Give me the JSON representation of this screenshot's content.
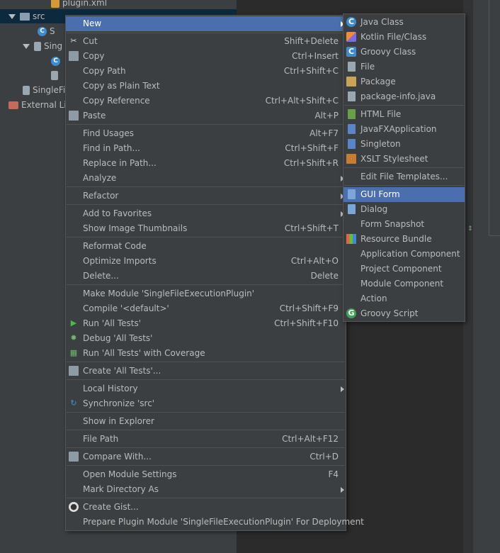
{
  "tree": {
    "plugin_xml": "plugin.xml",
    "src": "src",
    "item_s": "S",
    "sing": "Sing",
    "singlefi": "SingleFi",
    "external_libs": "External Libr"
  },
  "main_menu": {
    "new": "New",
    "cut": "Cut",
    "cut_sc": "Shift+Delete",
    "copy": "Copy",
    "copy_sc": "Ctrl+Insert",
    "copy_path": "Copy Path",
    "copy_path_sc": "Ctrl+Shift+C",
    "copy_plain": "Copy as Plain Text",
    "copy_ref": "Copy Reference",
    "copy_ref_sc": "Ctrl+Alt+Shift+C",
    "paste": "Paste",
    "paste_sc": "Alt+P",
    "find_usages": "Find Usages",
    "find_usages_sc": "Alt+F7",
    "find_path": "Find in Path...",
    "find_path_sc": "Ctrl+Shift+F",
    "replace_path": "Replace in Path...",
    "replace_path_sc": "Ctrl+Shift+R",
    "analyze": "Analyze",
    "refactor": "Refactor",
    "add_fav": "Add to Favorites",
    "show_thumbs": "Show Image Thumbnails",
    "show_thumbs_sc": "Ctrl+Shift+T",
    "reformat": "Reformat Code",
    "optimize": "Optimize Imports",
    "optimize_sc": "Ctrl+Alt+O",
    "delete": "Delete...",
    "delete_sc": "Delete",
    "make_module": "Make Module 'SingleFileExecutionPlugin'",
    "compile": "Compile '<default>'",
    "compile_sc": "Ctrl+Shift+F9",
    "run_tests": "Run 'All Tests'",
    "run_tests_sc": "Ctrl+Shift+F10",
    "debug_tests": "Debug 'All Tests'",
    "run_coverage": "Run 'All Tests' with Coverage",
    "create_tests": "Create 'All Tests'...",
    "local_history": "Local History",
    "sync": "Synchronize 'src'",
    "show_explorer": "Show in Explorer",
    "file_path": "File Path",
    "file_path_sc": "Ctrl+Alt+F12",
    "compare": "Compare With...",
    "compare_sc": "Ctrl+D",
    "module_settings": "Open Module Settings",
    "module_settings_sc": "F4",
    "mark_dir": "Mark Directory As",
    "create_gist": "Create Gist...",
    "prepare_plugin": "Prepare Plugin Module 'SingleFileExecutionPlugin' For Deployment"
  },
  "sub_menu": {
    "java_class": "Java Class",
    "kotlin": "Kotlin File/Class",
    "groovy_class": "Groovy Class",
    "file": "File",
    "package": "Package",
    "package_info": "package-info.java",
    "html_file": "HTML File",
    "javafx": "JavaFXApplication",
    "singleton": "Singleton",
    "xslt": "XSLT Stylesheet",
    "edit_templates": "Edit File Templates...",
    "gui_form": "GUI Form",
    "dialog": "Dialog",
    "form_snapshot": "Form Snapshot",
    "resource_bundle": "Resource Bundle",
    "app_component": "Application Component",
    "project_component": "Project Component",
    "module_component": "Module Component",
    "action": "Action",
    "groovy_script": "Groovy Script"
  },
  "icons": {
    "c_letter": "C",
    "g_letter": "G"
  },
  "colors": {
    "highlight": "#4b6eaf",
    "menu_bg": "#3c3f41",
    "tree_selection": "#0d293e"
  }
}
